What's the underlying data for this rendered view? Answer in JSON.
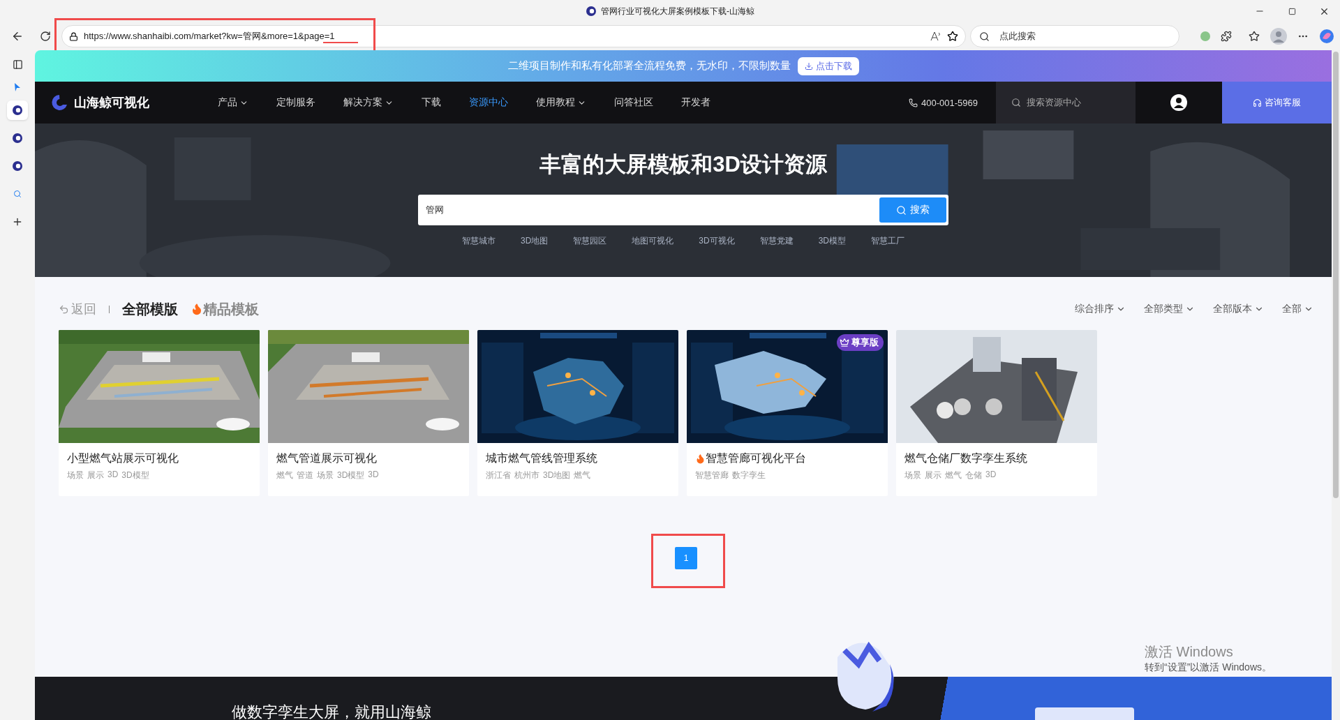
{
  "window": {
    "title": "管网行业可视化大屏案例模板下载-山海鲸"
  },
  "browser": {
    "url": "https://www.shanhaibi.com/market?kw=管网&more=1&page=1",
    "search_placeholder": "点此搜索"
  },
  "promo": {
    "text": "二维项目制作和私有化部署全流程免费，无水印，不限制数量",
    "button": "点击下载"
  },
  "nav": {
    "logo": "山海鲸可视化",
    "items": [
      {
        "label": "产品",
        "dropdown": true,
        "selected": false
      },
      {
        "label": "定制服务",
        "dropdown": false,
        "selected": false
      },
      {
        "label": "解决方案",
        "dropdown": true,
        "selected": false
      },
      {
        "label": "下载",
        "dropdown": false,
        "selected": false
      },
      {
        "label": "资源中心",
        "dropdown": false,
        "selected": true
      },
      {
        "label": "使用教程",
        "dropdown": true,
        "selected": false
      },
      {
        "label": "问答社区",
        "dropdown": false,
        "selected": false
      },
      {
        "label": "开发者",
        "dropdown": false,
        "selected": false
      }
    ],
    "phone": "400-001-5969",
    "search_placeholder": "搜索资源中心",
    "service": "咨询客服"
  },
  "hero": {
    "title": "丰富的大屏模板和3D设计资源",
    "query": "管网",
    "search_button": "搜索",
    "tags": [
      "智慧城市",
      "3D地图",
      "智慧园区",
      "地图可视化",
      "3D可视化",
      "智慧党建",
      "3D模型",
      "智慧工厂"
    ]
  },
  "filters": {
    "back": "返回",
    "tabs": [
      {
        "label": "全部模版",
        "selected": true,
        "hot": false
      },
      {
        "label": "精品模板",
        "selected": false,
        "hot": true
      }
    ],
    "sorts": [
      "综合排序",
      "全部类型",
      "全部版本",
      "全部"
    ]
  },
  "cards": [
    {
      "title": "小型燃气站展示可视化",
      "hot": false,
      "tags": [
        "场景",
        "展示",
        "3D",
        "3D模型"
      ]
    },
    {
      "title": "燃气管道展示可视化",
      "hot": false,
      "tags": [
        "燃气",
        "管道",
        "场景",
        "3D模型",
        "3D"
      ]
    },
    {
      "title": "城市燃气管线管理系统",
      "hot": false,
      "tags": [
        "浙江省",
        "杭州市",
        "3D地图",
        "燃气"
      ]
    },
    {
      "title": "智慧管廊可视化平台",
      "hot": true,
      "badge": "尊享版",
      "tags": [
        "智慧管廊",
        "数字孪生"
      ]
    },
    {
      "title": "燃气仓储厂数字孪生系统",
      "hot": false,
      "tags": [
        "场景",
        "展示",
        "燃气",
        "仓储",
        "3D"
      ]
    }
  ],
  "pagination": [
    {
      "label": "1",
      "selected": true
    }
  ],
  "footer": {
    "slogan": "做数字孪生大屏，就用山海鲸"
  },
  "os_notice": {
    "title": "激活 Windows",
    "text": "转到“设置”以激活 Windows。"
  }
}
